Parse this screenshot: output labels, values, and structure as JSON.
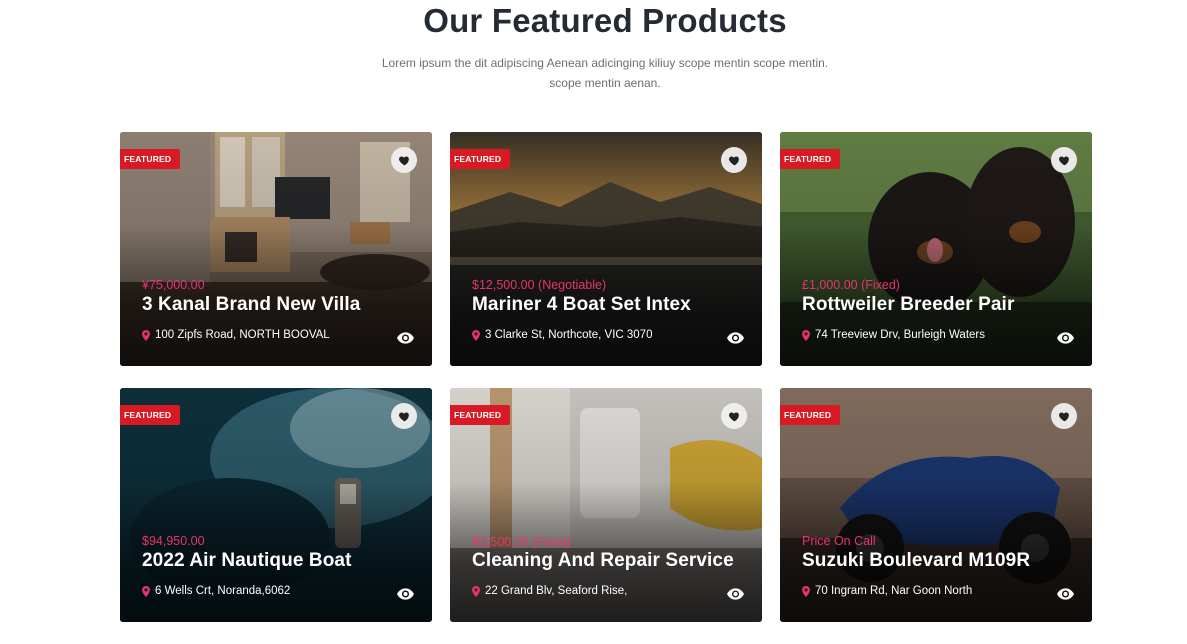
{
  "section": {
    "title": "Our Featured Products",
    "subtitle": "Lorem ipsum the dit adipiscing Aenean adicinging kiliuy scope mentin scope mentin. scope mentin aenan."
  },
  "colors": {
    "badge": "#d71a23",
    "price": "#e8336e",
    "title_text": "#242b33"
  },
  "icons": {
    "favorite": "heart-icon",
    "location": "map-pin-icon",
    "view": "eye-icon"
  },
  "products": [
    {
      "badge": "FEATURED",
      "price": "¥75,000.00",
      "title": "3 Kanal Brand New Villa",
      "location": "100 Zipfs Road, NORTH BOOVAL"
    },
    {
      "badge": "FEATURED",
      "price": "$12,500.00 (Negotiable)",
      "title": "Mariner 4 Boat Set Intex",
      "location": "3 Clarke St, Northcote, VIC 3070"
    },
    {
      "badge": "FEATURED",
      "price": "£1,000.00 (Fixed)",
      "title": "Rottweiler Breeder Pair",
      "location": "74 Treeview Drv, Burleigh Waters"
    },
    {
      "badge": "FEATURED",
      "price": "$94,950.00",
      "title": "2022 Air Nautique Boat",
      "location": "6 Wells Crt, Noranda,6062"
    },
    {
      "badge": "FEATURED",
      "price": "₽3,500.00 (Fixed)",
      "title": "Cleaning And Repair Service",
      "location": "22 Grand Blv, Seaford Rise,"
    },
    {
      "badge": "FEATURED",
      "price": "Price On Call",
      "title": "Suzuki Boulevard M109R",
      "location": "70 Ingram Rd, Nar Goon North"
    }
  ]
}
